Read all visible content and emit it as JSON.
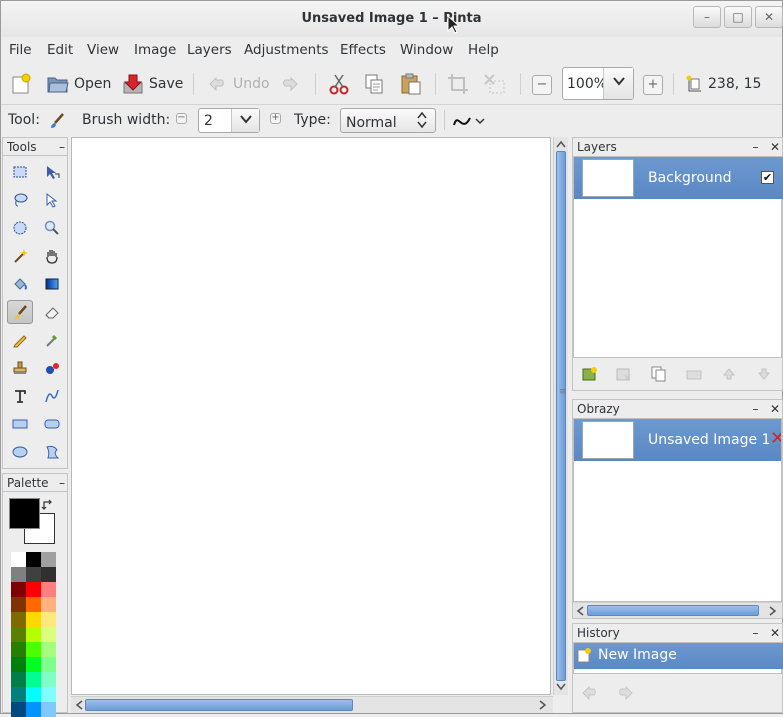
{
  "window": {
    "title": "Unsaved Image 1 – Pinta",
    "minimize": "–",
    "maximize": "□",
    "close": "✕"
  },
  "menubar": [
    "File",
    "Edit",
    "View",
    "Image",
    "Layers",
    "Adjustments",
    "Effects",
    "Window",
    "Help"
  ],
  "toolbar": {
    "open_label": "Open",
    "save_label": "Save",
    "undo_label": "Undo",
    "zoom_value": "100%",
    "cursor_position": "238, 15"
  },
  "options": {
    "tool_label": "Tool:",
    "brush_width_label": "Brush width:",
    "brush_width_value": "2",
    "type_label": "Type:",
    "type_value": "Normal"
  },
  "tools_panel": {
    "title": "Tools",
    "items": [
      "rectangle-select",
      "move-selected",
      "lasso-select",
      "move-selection",
      "ellipse-select",
      "zoom",
      "magic-wand",
      "pan",
      "paint-bucket",
      "gradient",
      "paintbrush",
      "eraser",
      "pencil",
      "color-picker",
      "clone-stamp",
      "recolor",
      "text",
      "line-curve",
      "rectangle",
      "rounded-rectangle",
      "ellipse",
      "freeform-shape"
    ],
    "active": "paintbrush"
  },
  "palette_panel": {
    "title": "Palette",
    "primary_color": "#000000",
    "secondary_color": "#ffffff",
    "colors": [
      [
        "#ffffff",
        "#000000",
        "#a0a0a0"
      ],
      [
        "#808080",
        "#404040",
        "#303030"
      ],
      [
        "#7f0000",
        "#ff0000",
        "#ff7f7f"
      ],
      [
        "#7f3300",
        "#ff6a00",
        "#ffb27f"
      ],
      [
        "#7f6a00",
        "#ffd800",
        "#ffe97f"
      ],
      [
        "#5b7f00",
        "#b6ff00",
        "#daff7f"
      ],
      [
        "#267f00",
        "#4cff00",
        "#a5ff7f"
      ],
      [
        "#007f0e",
        "#00ff21",
        "#7fff8e"
      ],
      [
        "#007f46",
        "#00ff90",
        "#7fffc5"
      ],
      [
        "#007f7f",
        "#00ffff",
        "#7fffff"
      ],
      [
        "#004a7f",
        "#0094ff",
        "#7fc9ff"
      ]
    ]
  },
  "layers_panel": {
    "title": "Layers",
    "items": [
      {
        "name": "Background",
        "visible": true
      }
    ]
  },
  "images_panel": {
    "title": "Obrazy",
    "items": [
      {
        "name": "Unsaved Image 1"
      }
    ]
  },
  "history_panel": {
    "title": "History",
    "items": [
      {
        "name": "New Image"
      }
    ]
  },
  "colors": {
    "selection": "#5a88c4",
    "scroll_thumb": "#7aa6de"
  }
}
